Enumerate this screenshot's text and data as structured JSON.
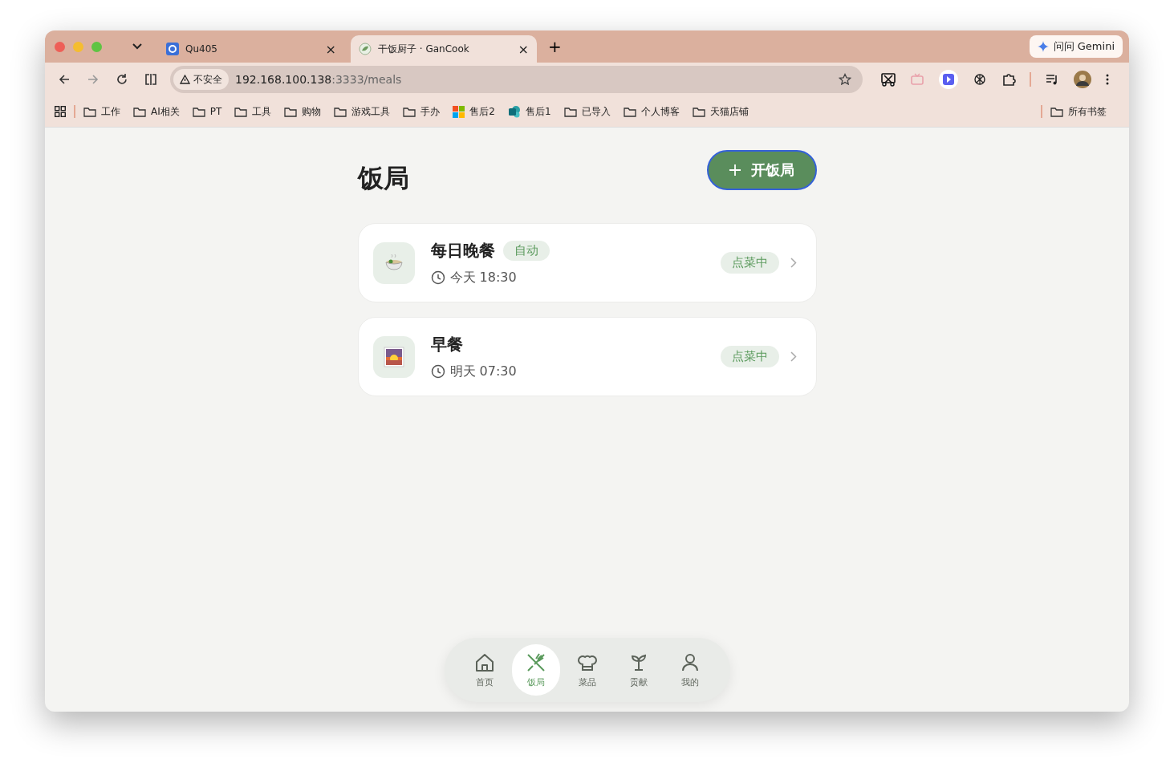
{
  "browser": {
    "tabs": [
      {
        "title": "Qu405",
        "selected": false,
        "close": "×"
      },
      {
        "title": "干饭厨子 · GanCook",
        "selected": true,
        "close": "×"
      }
    ],
    "new_tab": "+",
    "gemini": "问问 Gemini",
    "security": "不安全",
    "url_host": "192.168.100.138",
    "url_rest": ":3333/meals",
    "bookmarks": [
      {
        "label": "工作",
        "kind": "folder"
      },
      {
        "label": "AI相关",
        "kind": "folder"
      },
      {
        "label": "PT",
        "kind": "folder"
      },
      {
        "label": "工具",
        "kind": "folder"
      },
      {
        "label": "购物",
        "kind": "folder"
      },
      {
        "label": "游戏工具",
        "kind": "folder"
      },
      {
        "label": "手办",
        "kind": "folder"
      },
      {
        "label": "售后2",
        "kind": "tiles"
      },
      {
        "label": "售后1",
        "kind": "app"
      },
      {
        "label": "已导入",
        "kind": "folder"
      },
      {
        "label": "个人博客",
        "kind": "folder"
      },
      {
        "label": "天猫店铺",
        "kind": "folder"
      }
    ],
    "all_bookmarks": "所有书签"
  },
  "page": {
    "title": "饭局",
    "new_button": "开饭局",
    "meals": [
      {
        "name": "每日晚餐",
        "badge": "自动",
        "time": "今天 18:30",
        "status": "点菜中"
      },
      {
        "name": "早餐",
        "time": "明天 07:30",
        "status": "点菜中"
      }
    ]
  },
  "nav": [
    {
      "label": "首页",
      "selected": false
    },
    {
      "label": "饭局",
      "selected": true
    },
    {
      "label": "菜品",
      "selected": false
    },
    {
      "label": "贡献",
      "selected": false
    },
    {
      "label": "我的",
      "selected": false
    }
  ]
}
